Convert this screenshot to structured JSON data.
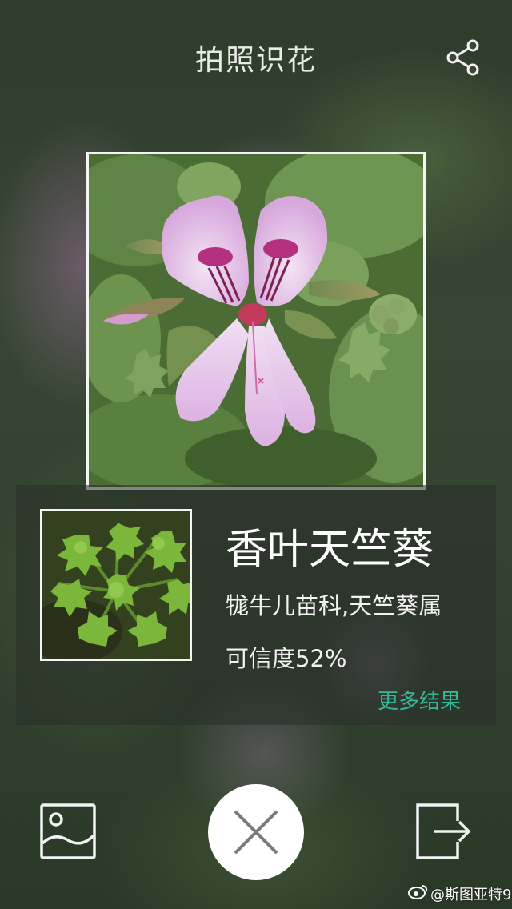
{
  "header": {
    "title": "拍照识花",
    "share_icon": "share-icon"
  },
  "result": {
    "name": "香叶天竺葵",
    "family": "牻牛儿苗科,天竺葵属",
    "confidence": "可信度52%",
    "more_label": "更多结果"
  },
  "actions": {
    "gallery_icon": "image-gallery-icon",
    "close_icon": "close-icon",
    "export_icon": "export-icon"
  },
  "watermark": {
    "text": "@斯图亚特9"
  },
  "colors": {
    "accent": "#35b89a",
    "text": "#ffffff"
  }
}
